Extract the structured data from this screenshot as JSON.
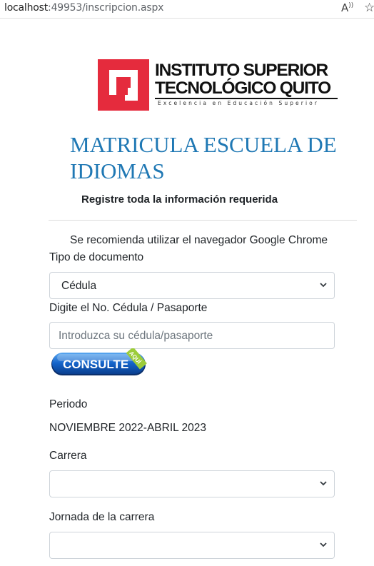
{
  "browser": {
    "url_host": "localhost",
    "url_rest": ":49953/inscripcion.aspx",
    "read_aloud_label": "A",
    "read_aloud_sup": "))",
    "favorite_icon": "star-icon"
  },
  "logo": {
    "line1": "INSTITUTO SUPERIOR",
    "line2": "TECNOLÓGICO QUITO",
    "tagline": "Excelencia en Educación Superior",
    "brand_color": "#e52b3d"
  },
  "page": {
    "title": "MATRICULA ESCUELA DE IDIOMAS",
    "subtitle": "Registre toda la información requerida",
    "recommendation": "Se recomienda utilizar el navegador Google Chrome",
    "title_color": "#1f78b4"
  },
  "form": {
    "doc_type_label": "Tipo de documento",
    "doc_type_value": "Cédula",
    "doc_number_label": "Digite el No. Cédula / Pasaporte",
    "doc_number_placeholder": "Introduzca su cédula/pasaporte",
    "consult_button": {
      "label": "CONSULTE",
      "badge": "AQUÍ"
    },
    "period_label": "Periodo",
    "period_value": "NOVIEMBRE 2022-ABRIL 2023",
    "career_label": "Carrera",
    "career_value": "",
    "shift_label": "Jornada de la carrera",
    "shift_value": ""
  }
}
